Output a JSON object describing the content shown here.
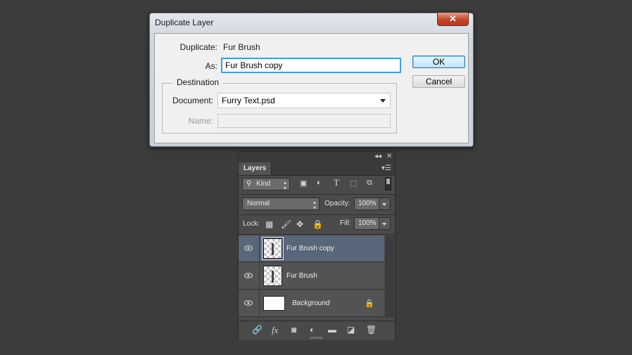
{
  "dialog": {
    "title": "Duplicate Layer",
    "close_glyph": "✕",
    "duplicate_label": "Duplicate:",
    "duplicate_value": "Fur Brush",
    "as_label": "As:",
    "as_value": "Fur Brush copy",
    "destination_legend": "Destination",
    "document_label": "Document:",
    "document_value": "Furry Text.psd",
    "name_label": "Name:",
    "name_value": "",
    "ok_label": "OK",
    "cancel_label": "Cancel"
  },
  "layers_panel": {
    "tab_label": "Layers",
    "filter_kind": "Kind",
    "filter_icons": [
      "image-filter-icon",
      "adjustment-filter-icon",
      "type-filter-icon",
      "shape-filter-icon",
      "smart-object-filter-icon"
    ],
    "blend_mode": "Normal",
    "opacity_label": "Opacity:",
    "opacity_value": "100%",
    "lock_label": "Lock:",
    "fill_label": "Fill:",
    "fill_value": "100%",
    "type_glyph": "T",
    "fx_glyph": "fx",
    "layers": [
      {
        "name": "Fur Brush copy",
        "selected": true,
        "locked": false
      },
      {
        "name": "Fur Brush",
        "selected": false,
        "locked": false
      },
      {
        "name": "Background",
        "selected": false,
        "locked": true
      }
    ],
    "bottom_icons": [
      "link-icon",
      "fx-icon",
      "mask-icon",
      "adjustment-icon",
      "folder-icon",
      "new-layer-icon",
      "trash-icon"
    ]
  },
  "colors": {
    "background": "#3c3c3c",
    "selected_layer": "#58667a",
    "focus_blue": "#3e9fe0",
    "close_red": "#c4442a"
  }
}
